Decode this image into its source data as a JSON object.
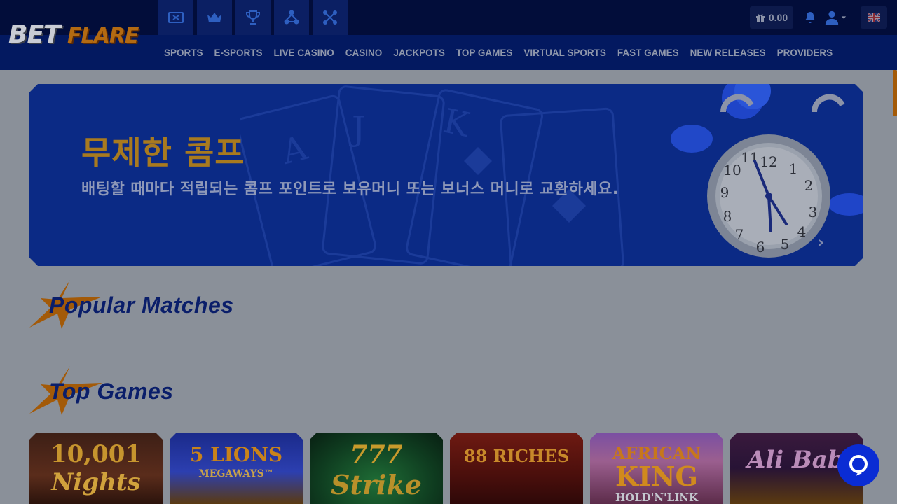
{
  "header": {
    "logo": {
      "part1": "BET",
      "part2": "FLARE"
    },
    "top_icons": [
      "tickets-icon",
      "crown-icon",
      "trophy-icon",
      "network-icon",
      "molecule-icon"
    ],
    "nav": [
      "SPORTS",
      "E-SPORTS",
      "LIVE CASINO",
      "CASINO",
      "JACKPOTS",
      "TOP GAMES",
      "VIRTUAL SPORTS",
      "FAST GAMES",
      "NEW RELEASES",
      "PROVIDERS"
    ],
    "balance": "0.00",
    "language_flag": "uk-flag-icon"
  },
  "banner": {
    "title": "무제한 콤프",
    "subtitle": "배팅할 때마다 적립되는 콤프 포인트로 보유머니 또는 보너스 머니로 교환하세요."
  },
  "sections": {
    "popular_matches": "Popular Matches",
    "top_games": "Top Games"
  },
  "games": [
    {
      "line1": "10,001",
      "line2": "Nights"
    },
    {
      "line1": "5 LIONS",
      "line2": "MEGAWAYS™"
    },
    {
      "line1": "777",
      "line2": "Strike"
    },
    {
      "line1": "88 RICHES",
      "line2": ""
    },
    {
      "line1": "AFRICAN",
      "line2": "KING",
      "line3": "HOLD'N'LINK"
    },
    {
      "line1": "Ali Baba",
      "line2": ""
    }
  ],
  "colors": {
    "header_bg": "#031960",
    "header_strip": "#020d3a",
    "accent_orange": "#a35a08",
    "page_bg": "#8a9099",
    "banner_bg": "#0b2a85",
    "chat_button": "#0a2cd4"
  }
}
